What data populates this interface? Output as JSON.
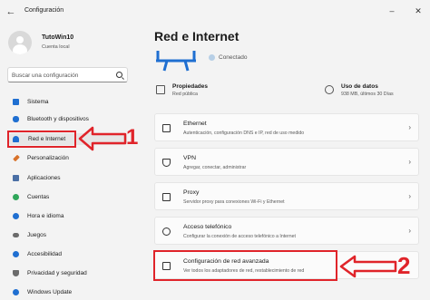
{
  "window": {
    "title": "Configuración",
    "back_glyph": "←",
    "minimize_glyph": "–",
    "close_glyph": "✕"
  },
  "user": {
    "name": "TutoWin10",
    "account": "Cuenta local"
  },
  "search": {
    "placeholder": "Buscar una configuración"
  },
  "sidebar": {
    "items": [
      {
        "label": "Sistema",
        "icon": "monitor-icon",
        "color": "#1f6fd1"
      },
      {
        "label": "Bluetooth y dispositivos",
        "icon": "bluetooth-icon",
        "color": "#1f6fd1"
      },
      {
        "label": "Red e Internet",
        "icon": "wifi-icon",
        "color": "#1f6fd1",
        "active": true
      },
      {
        "label": "Personalización",
        "icon": "brush-icon",
        "color": "#d8722a"
      },
      {
        "label": "Aplicaciones",
        "icon": "apps-icon",
        "color": "#4a6fa5"
      },
      {
        "label": "Cuentas",
        "icon": "person-icon",
        "color": "#2fa65a"
      },
      {
        "label": "Hora e idioma",
        "icon": "globe-clock-icon",
        "color": "#1f6fd1"
      },
      {
        "label": "Juegos",
        "icon": "gamepad-icon",
        "color": "#6b6b6b"
      },
      {
        "label": "Accesibilidad",
        "icon": "accessibility-icon",
        "color": "#1f6fd1"
      },
      {
        "label": "Privacidad y seguridad",
        "icon": "shield-icon",
        "color": "#6b6b6b"
      },
      {
        "label": "Windows Update",
        "icon": "update-icon",
        "color": "#1f6fd1"
      }
    ]
  },
  "main": {
    "title": "Red e Internet",
    "status": "Conectado",
    "properties": {
      "title": "Propiedades",
      "subtitle": "Red pública"
    },
    "data_usage": {
      "title": "Uso de datos",
      "subtitle": "938 MB, últimos 30 Días"
    },
    "cards": [
      {
        "title": "Ethernet",
        "subtitle": "Autenticación, configuración DNS e IP, red de uso medido",
        "icon": "ethernet-icon"
      },
      {
        "title": "VPN",
        "subtitle": "Agregar, conectar, administrar",
        "icon": "vpn-shield-icon"
      },
      {
        "title": "Proxy",
        "subtitle": "Servidor proxy para conexiones Wi-Fi y Ethernet",
        "icon": "proxy-icon"
      },
      {
        "title": "Acceso telefónico",
        "subtitle": "Configurar la conexión de acceso telefónico a Internet",
        "icon": "dialup-icon"
      },
      {
        "title": "Configuración de red avanzada",
        "subtitle": "Ver todos los adaptadores de red, restablecimiento de red",
        "icon": "network-adapter-icon"
      }
    ]
  },
  "annotations": {
    "step1": "1",
    "step2": "2",
    "highlight_color": "#e0242a"
  },
  "colors": {
    "accent": "#1f6fd1",
    "background": "#f3f3f3"
  }
}
